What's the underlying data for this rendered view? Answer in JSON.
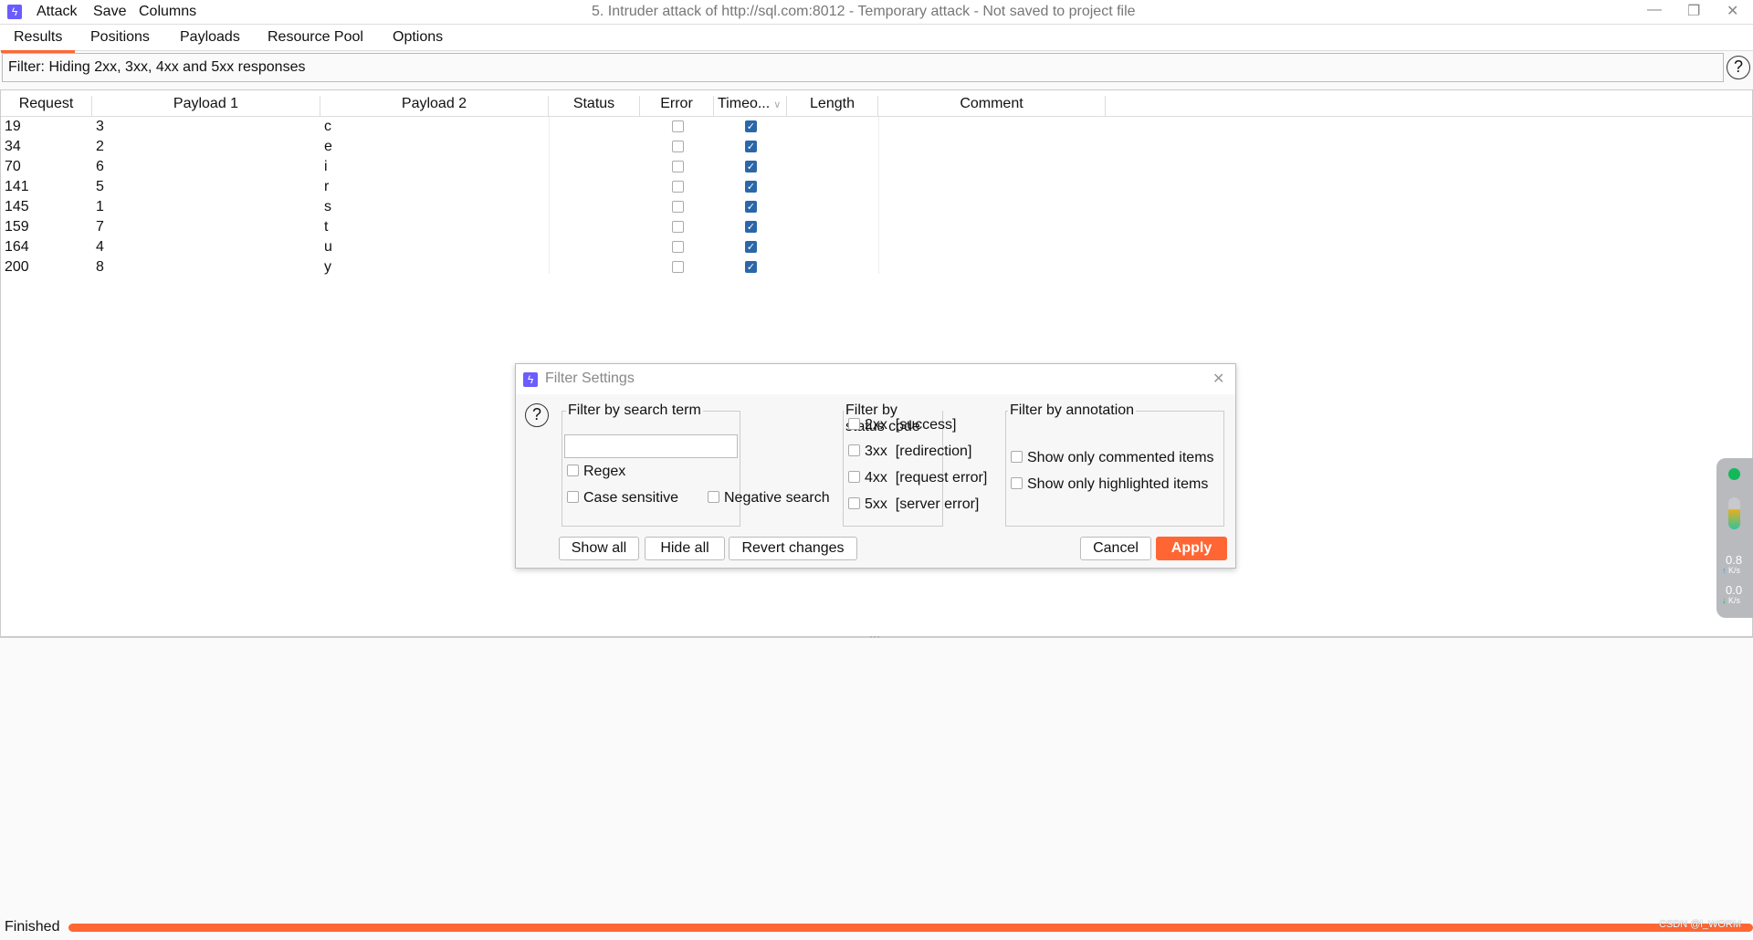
{
  "menu": {
    "items": [
      "Attack",
      "Save",
      "Columns"
    ]
  },
  "window": {
    "title": "5. Intruder attack of http://sql.com:8012 - Temporary attack - Not saved to project file"
  },
  "tabs": [
    "Results",
    "Positions",
    "Payloads",
    "Resource Pool",
    "Options"
  ],
  "filter": {
    "text": "Filter: Hiding 2xx, 3xx, 4xx and 5xx responses",
    "help": "?"
  },
  "table": {
    "columns": [
      "Request",
      "Payload 1",
      "Payload 2",
      "Status",
      "Error",
      "Timeo...",
      "Length",
      "Comment"
    ],
    "rows": [
      {
        "request": "19",
        "p1": "3",
        "p2": "c",
        "error": false,
        "timeout": true
      },
      {
        "request": "34",
        "p1": "2",
        "p2": "e",
        "error": false,
        "timeout": true
      },
      {
        "request": "70",
        "p1": "6",
        "p2": "i",
        "error": false,
        "timeout": true
      },
      {
        "request": "141",
        "p1": "5",
        "p2": "r",
        "error": false,
        "timeout": true
      },
      {
        "request": "145",
        "p1": "1",
        "p2": "s",
        "error": false,
        "timeout": true
      },
      {
        "request": "159",
        "p1": "7",
        "p2": "t",
        "error": false,
        "timeout": true
      },
      {
        "request": "164",
        "p1": "4",
        "p2": "u",
        "error": false,
        "timeout": true
      },
      {
        "request": "200",
        "p1": "8",
        "p2": "y",
        "error": false,
        "timeout": true
      }
    ]
  },
  "dialog": {
    "title": "Filter Settings",
    "help": "?",
    "search": {
      "label": "Filter by search term",
      "value": "",
      "regex": "Regex",
      "case": "Case sensitive",
      "negative": "Negative search"
    },
    "status": {
      "label": "Filter by status code",
      "options": [
        {
          "code": "2xx",
          "desc": "[success]"
        },
        {
          "code": "3xx",
          "desc": "[redirection]"
        },
        {
          "code": "4xx",
          "desc": "[request error]"
        },
        {
          "code": "5xx",
          "desc": "[server error]"
        }
      ]
    },
    "annotation": {
      "label": "Filter by annotation",
      "commented": "Show only commented items",
      "highlighted": "Show only highlighted items"
    },
    "buttons": {
      "show_all": "Show all",
      "hide_all": "Hide all",
      "revert": "Revert changes",
      "cancel": "Cancel",
      "apply": "Apply"
    }
  },
  "widget": {
    "up": "0.8",
    "down": "0.0",
    "unit": "K/s"
  },
  "status": {
    "text": "Finished",
    "progress": 100,
    "watermark": "CSDN @l_WORM"
  },
  "colors": {
    "accent": "#ff6633",
    "check": "#2b67a8",
    "logo": "#6a5cff"
  }
}
